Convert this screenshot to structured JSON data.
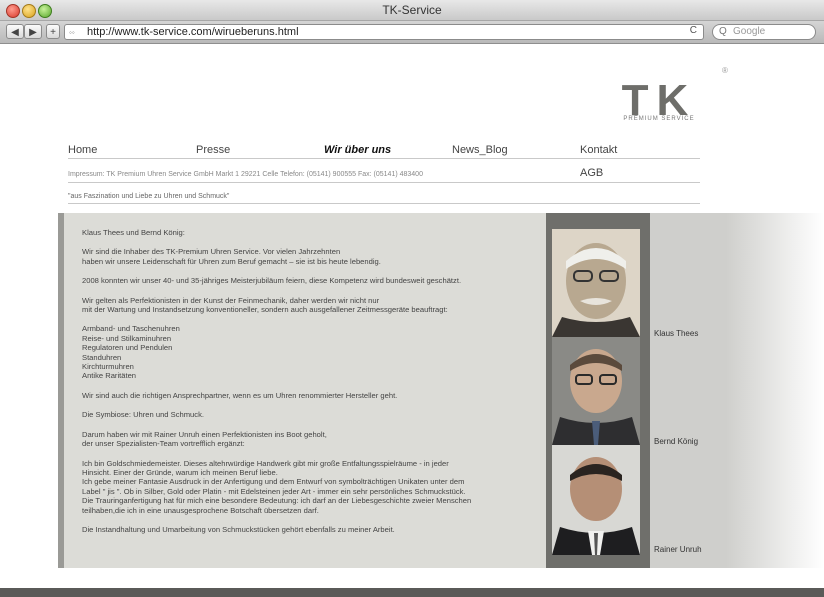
{
  "window": {
    "title": "TK-Service"
  },
  "toolbar": {
    "back_label": "◀",
    "forward_label": "▶",
    "add_label": "+",
    "url": "http://www.tk-service.com/wirueberuns.html",
    "reload_label": "C",
    "search_placeholder": "Google"
  },
  "logo": {
    "text": "TK",
    "tagline": "PREMIUM SERVICE",
    "registered": "®"
  },
  "nav": {
    "items": [
      {
        "label": "Home"
      },
      {
        "label": "Presse"
      },
      {
        "label": "Wir über uns"
      },
      {
        "label": "News_Blog"
      },
      {
        "label": "Kontakt"
      }
    ],
    "agb": "AGB"
  },
  "impressum": "Impressum:   TK Premium Uhren Service GmbH   Markt 1   29221 Celle   Telefon: (05141) 900555   Fax: (05141) 483400",
  "quote": "\"aus Faszination und Liebe zu Uhren und Schmuck\"",
  "body": {
    "paragraphs": [
      "Klaus Thees und Bernd König:",
      "Wir sind die Inhaber des TK-Premium Uhren Service. Vor vielen Jahrzehnten\nhaben wir unsere Leidenschaft für Uhren zum Beruf gemacht – sie ist bis heute lebendig.",
      "2008 konnten wir unser 40- und 35-jähriges Meisterjubiläum feiern, diese Kompetenz wird bundesweit geschätzt.",
      "Wir gelten als Perfektionisten in der Kunst der Feinmechanik, daher werden wir nicht nur\nmit der Wartung und Instandsetzung konventioneller, sondern auch ausgefallener Zeitmessgeräte beauftragt:",
      "Armband- und Taschenuhren\nReise- und Stilkaminuhren\nRegulatoren und Pendulen\nStanduhren\nKirchturmuhren\nAntike Raritäten",
      "Wir sind auch die richtigen Ansprechpartner, wenn es um Uhren renommierter Hersteller geht.",
      "Die Symbiose: Uhren und Schmuck.",
      "Darum haben wir mit Rainer Unruh einen Perfektionisten ins Boot geholt,\nder unser Spezialisten-Team vortrefflich ergänzt:",
      "Ich bin Goldschmiedemeister. Dieses altehrwürdige Handwerk gibt mir große Entfaltungsspielräume - in jeder\nHinsicht. Einer der Gründe, warum ich meinen Beruf liebe.\nIch gebe meiner Fantasie Ausdruck in der Anfertigung und dem Entwurf von symbolträchtigen Unikaten unter dem\nLabel \" jis \". Ob in Silber, Gold oder Platin - mit Edelsteinen jeder Art - immer ein sehr persönliches Schmuckstück.\nDie Trauringanfertigung hat für mich eine besondere Bedeutung: ich darf an der Liebesgeschichte zweier Menschen\nteilhaben,die ich in eine unausgesprochene Botschaft übersetzen darf.",
      "Die Instandhaltung und Umarbeitung von Schmuckstücken gehört ebenfalls zu meiner Arbeit."
    ]
  },
  "people": [
    {
      "name": "Klaus Thees"
    },
    {
      "name": "Bernd König"
    },
    {
      "name": "Rainer Unruh"
    }
  ],
  "colors": {
    "panel": "#dcdcd7",
    "photo_frame": "#6f6f6b",
    "logo": "#6e6e6a"
  }
}
